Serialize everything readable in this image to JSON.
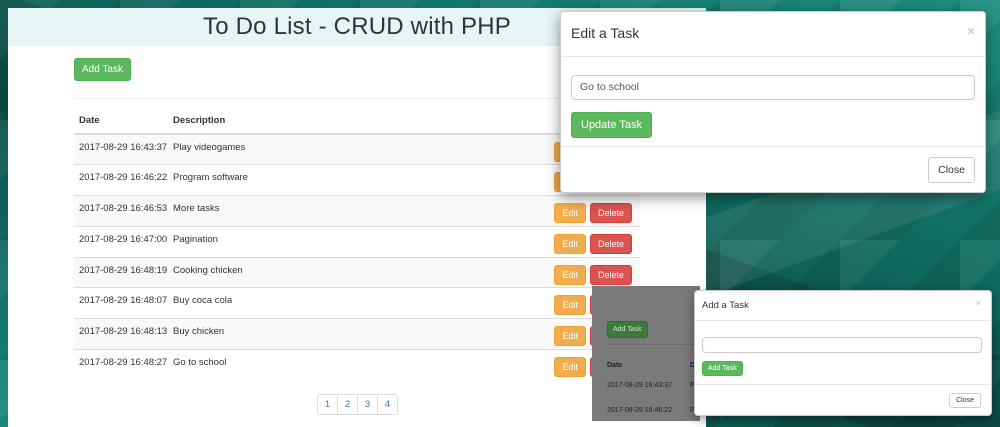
{
  "page": {
    "title": "To Do List - CRUD with PHP",
    "add_task_label": "Add Task"
  },
  "table": {
    "headers": {
      "date": "Date",
      "description": "Description"
    },
    "edit_label": "Edit",
    "delete_label": "Delete",
    "rows": [
      {
        "date": "2017-08-29 16:43:37",
        "description": "Play videogames"
      },
      {
        "date": "2017-08-29 16:46:22",
        "description": "Program software"
      },
      {
        "date": "2017-08-29 16:46:53",
        "description": "More tasks"
      },
      {
        "date": "2017-08-29 16:47:00",
        "description": "Pagination"
      },
      {
        "date": "2017-08-29 16:48:19",
        "description": "Cooking chicken"
      },
      {
        "date": "2017-08-29 16:48:07",
        "description": "Buy coca cola"
      },
      {
        "date": "2017-08-29 16:48:13",
        "description": "Buy chicken"
      },
      {
        "date": "2017-08-29 16:48:27",
        "description": "Go to school"
      }
    ]
  },
  "pagination": {
    "pages": [
      "1",
      "2",
      "3",
      "4"
    ]
  },
  "edit_modal": {
    "title": "Edit a Task",
    "close_x": "×",
    "input_value": "Go to school",
    "update_label": "Update Task",
    "close_label": "Close"
  },
  "preview": {
    "add_task_label": "Add Task",
    "date_header": "Date",
    "desc_header_fragment": "D",
    "rows": [
      "2017-08-29 16:43:37",
      "2017-08-29 16:46:22"
    ],
    "row_fragment": "P"
  },
  "add_modal": {
    "title": "Add a Task",
    "close_x": "×",
    "input_value": "",
    "add_label": "Add Task",
    "close_label": "Close"
  },
  "colors": {
    "success": "#5cb85c",
    "warning": "#f0ad4e",
    "danger": "#d9534f",
    "header_bg": "#e6f4f6",
    "background_teal": "#0f6b60"
  }
}
